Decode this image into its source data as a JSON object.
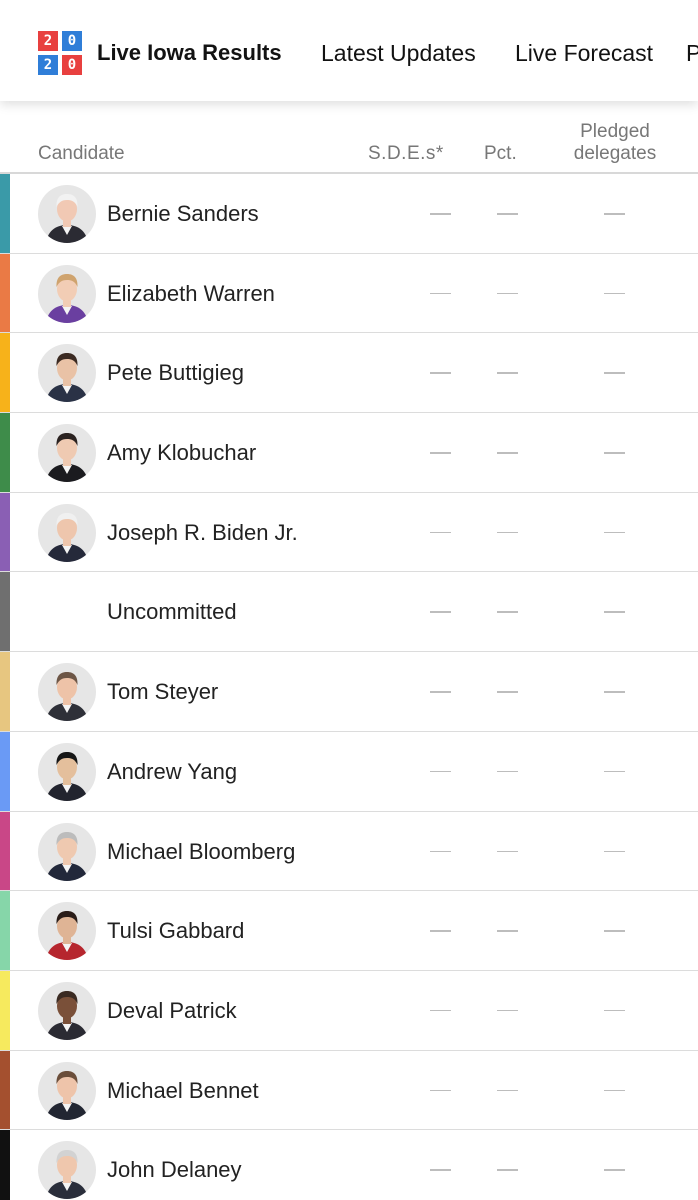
{
  "nav": {
    "logo_digits": [
      "2",
      "0",
      "2",
      "0"
    ],
    "title": "Live Iowa Results",
    "items": [
      "Latest Updates",
      "Live Forecast",
      "P"
    ]
  },
  "table": {
    "headers": {
      "candidate": "Candidate",
      "sdes": "S.D.E.s*",
      "pct": "Pct.",
      "pledged_line1": "Pledged",
      "pledged_line2": "delegates"
    },
    "empty_value": "—",
    "rows": [
      {
        "name": "Bernie Sanders",
        "color": "#3a9aa8",
        "skin": "#f1c9b4",
        "hair": "#f2f2f2",
        "suit": "#2b2b33",
        "avatar": "bernie-sanders-avatar"
      },
      {
        "name": "Elizabeth Warren",
        "color": "#ea7a45",
        "skin": "#f2cdb5",
        "hair": "#cfa36e",
        "suit": "#6a3fa0",
        "avatar": "elizabeth-warren-avatar"
      },
      {
        "name": "Pete Buttigieg",
        "color": "#f7b21a",
        "skin": "#e9c2a6",
        "hair": "#3b2a22",
        "suit": "#2a3246",
        "avatar": "pete-buttigieg-avatar"
      },
      {
        "name": "Amy Klobuchar",
        "color": "#3e8c4a",
        "skin": "#efcab2",
        "hair": "#2a2220",
        "suit": "#1b1b1f",
        "avatar": "amy-klobuchar-avatar"
      },
      {
        "name": "Joseph R. Biden Jr.",
        "color": "#8a5fb4",
        "skin": "#eec6ad",
        "hair": "#f0f0f0",
        "suit": "#25293a",
        "avatar": "joseph-biden-avatar"
      },
      {
        "name": "Uncommitted",
        "color": "#6f6f6f",
        "skin": "",
        "hair": "",
        "suit": "",
        "avatar": ""
      },
      {
        "name": "Tom Steyer",
        "color": "#e7c680",
        "skin": "#eec3a8",
        "hair": "#6d5646",
        "suit": "#2e3038",
        "avatar": "tom-steyer-avatar"
      },
      {
        "name": "Andrew Yang",
        "color": "#6a9af5",
        "skin": "#e4bf9c",
        "hair": "#161616",
        "suit": "#22242e",
        "avatar": "andrew-yang-avatar"
      },
      {
        "name": "Michael Bloomberg",
        "color": "#c94787",
        "skin": "#efc9b0",
        "hair": "#bcbcbc",
        "suit": "#22283a",
        "avatar": "michael-bloomberg-avatar"
      },
      {
        "name": "Tulsi Gabbard",
        "color": "#86d6a9",
        "skin": "#dfb495",
        "hair": "#2a1d18",
        "suit": "#b6262e",
        "avatar": "tulsi-gabbard-avatar"
      },
      {
        "name": "Deval Patrick",
        "color": "#f6ea5e",
        "skin": "#7a5039",
        "hair": "#3a2a22",
        "suit": "#2b2b33",
        "avatar": "deval-patrick-avatar"
      },
      {
        "name": "Michael Bennet",
        "color": "#a4502f",
        "skin": "#eec4aa",
        "hair": "#6b4e3a",
        "suit": "#222632",
        "avatar": "michael-bennet-avatar"
      },
      {
        "name": "John Delaney",
        "color": "#111111",
        "skin": "#efc7ad",
        "hair": "#d2d2d2",
        "suit": "#2a2e3b",
        "avatar": "john-delaney-avatar"
      }
    ]
  },
  "colors": {
    "logo_red": "#e8403f",
    "logo_blue": "#2f7ed8"
  }
}
